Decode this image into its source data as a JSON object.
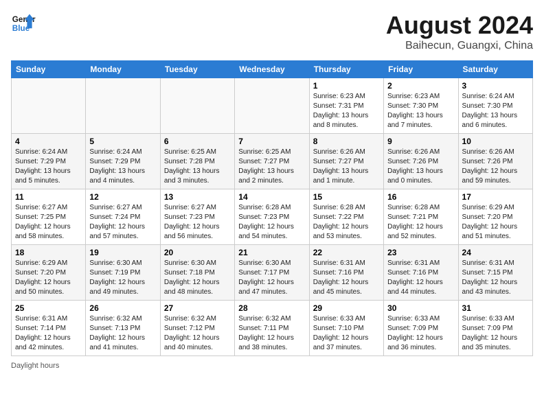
{
  "header": {
    "logo_line1": "General",
    "logo_line2": "Blue",
    "month_title": "August 2024",
    "location": "Baihecun, Guangxi, China"
  },
  "weekdays": [
    "Sunday",
    "Monday",
    "Tuesday",
    "Wednesday",
    "Thursday",
    "Friday",
    "Saturday"
  ],
  "weeks": [
    [
      {
        "day": "",
        "info": ""
      },
      {
        "day": "",
        "info": ""
      },
      {
        "day": "",
        "info": ""
      },
      {
        "day": "",
        "info": ""
      },
      {
        "day": "1",
        "info": "Sunrise: 6:23 AM\nSunset: 7:31 PM\nDaylight: 13 hours and 8 minutes."
      },
      {
        "day": "2",
        "info": "Sunrise: 6:23 AM\nSunset: 7:30 PM\nDaylight: 13 hours and 7 minutes."
      },
      {
        "day": "3",
        "info": "Sunrise: 6:24 AM\nSunset: 7:30 PM\nDaylight: 13 hours and 6 minutes."
      }
    ],
    [
      {
        "day": "4",
        "info": "Sunrise: 6:24 AM\nSunset: 7:29 PM\nDaylight: 13 hours and 5 minutes."
      },
      {
        "day": "5",
        "info": "Sunrise: 6:24 AM\nSunset: 7:29 PM\nDaylight: 13 hours and 4 minutes."
      },
      {
        "day": "6",
        "info": "Sunrise: 6:25 AM\nSunset: 7:28 PM\nDaylight: 13 hours and 3 minutes."
      },
      {
        "day": "7",
        "info": "Sunrise: 6:25 AM\nSunset: 7:27 PM\nDaylight: 13 hours and 2 minutes."
      },
      {
        "day": "8",
        "info": "Sunrise: 6:26 AM\nSunset: 7:27 PM\nDaylight: 13 hours and 1 minute."
      },
      {
        "day": "9",
        "info": "Sunrise: 6:26 AM\nSunset: 7:26 PM\nDaylight: 13 hours and 0 minutes."
      },
      {
        "day": "10",
        "info": "Sunrise: 6:26 AM\nSunset: 7:26 PM\nDaylight: 12 hours and 59 minutes."
      }
    ],
    [
      {
        "day": "11",
        "info": "Sunrise: 6:27 AM\nSunset: 7:25 PM\nDaylight: 12 hours and 58 minutes."
      },
      {
        "day": "12",
        "info": "Sunrise: 6:27 AM\nSunset: 7:24 PM\nDaylight: 12 hours and 57 minutes."
      },
      {
        "day": "13",
        "info": "Sunrise: 6:27 AM\nSunset: 7:23 PM\nDaylight: 12 hours and 56 minutes."
      },
      {
        "day": "14",
        "info": "Sunrise: 6:28 AM\nSunset: 7:23 PM\nDaylight: 12 hours and 54 minutes."
      },
      {
        "day": "15",
        "info": "Sunrise: 6:28 AM\nSunset: 7:22 PM\nDaylight: 12 hours and 53 minutes."
      },
      {
        "day": "16",
        "info": "Sunrise: 6:28 AM\nSunset: 7:21 PM\nDaylight: 12 hours and 52 minutes."
      },
      {
        "day": "17",
        "info": "Sunrise: 6:29 AM\nSunset: 7:20 PM\nDaylight: 12 hours and 51 minutes."
      }
    ],
    [
      {
        "day": "18",
        "info": "Sunrise: 6:29 AM\nSunset: 7:20 PM\nDaylight: 12 hours and 50 minutes."
      },
      {
        "day": "19",
        "info": "Sunrise: 6:30 AM\nSunset: 7:19 PM\nDaylight: 12 hours and 49 minutes."
      },
      {
        "day": "20",
        "info": "Sunrise: 6:30 AM\nSunset: 7:18 PM\nDaylight: 12 hours and 48 minutes."
      },
      {
        "day": "21",
        "info": "Sunrise: 6:30 AM\nSunset: 7:17 PM\nDaylight: 12 hours and 47 minutes."
      },
      {
        "day": "22",
        "info": "Sunrise: 6:31 AM\nSunset: 7:16 PM\nDaylight: 12 hours and 45 minutes."
      },
      {
        "day": "23",
        "info": "Sunrise: 6:31 AM\nSunset: 7:16 PM\nDaylight: 12 hours and 44 minutes."
      },
      {
        "day": "24",
        "info": "Sunrise: 6:31 AM\nSunset: 7:15 PM\nDaylight: 12 hours and 43 minutes."
      }
    ],
    [
      {
        "day": "25",
        "info": "Sunrise: 6:31 AM\nSunset: 7:14 PM\nDaylight: 12 hours and 42 minutes."
      },
      {
        "day": "26",
        "info": "Sunrise: 6:32 AM\nSunset: 7:13 PM\nDaylight: 12 hours and 41 minutes."
      },
      {
        "day": "27",
        "info": "Sunrise: 6:32 AM\nSunset: 7:12 PM\nDaylight: 12 hours and 40 minutes."
      },
      {
        "day": "28",
        "info": "Sunrise: 6:32 AM\nSunset: 7:11 PM\nDaylight: 12 hours and 38 minutes."
      },
      {
        "day": "29",
        "info": "Sunrise: 6:33 AM\nSunset: 7:10 PM\nDaylight: 12 hours and 37 minutes."
      },
      {
        "day": "30",
        "info": "Sunrise: 6:33 AM\nSunset: 7:09 PM\nDaylight: 12 hours and 36 minutes."
      },
      {
        "day": "31",
        "info": "Sunrise: 6:33 AM\nSunset: 7:09 PM\nDaylight: 12 hours and 35 minutes."
      }
    ]
  ],
  "footer": {
    "daylight_label": "Daylight hours"
  }
}
